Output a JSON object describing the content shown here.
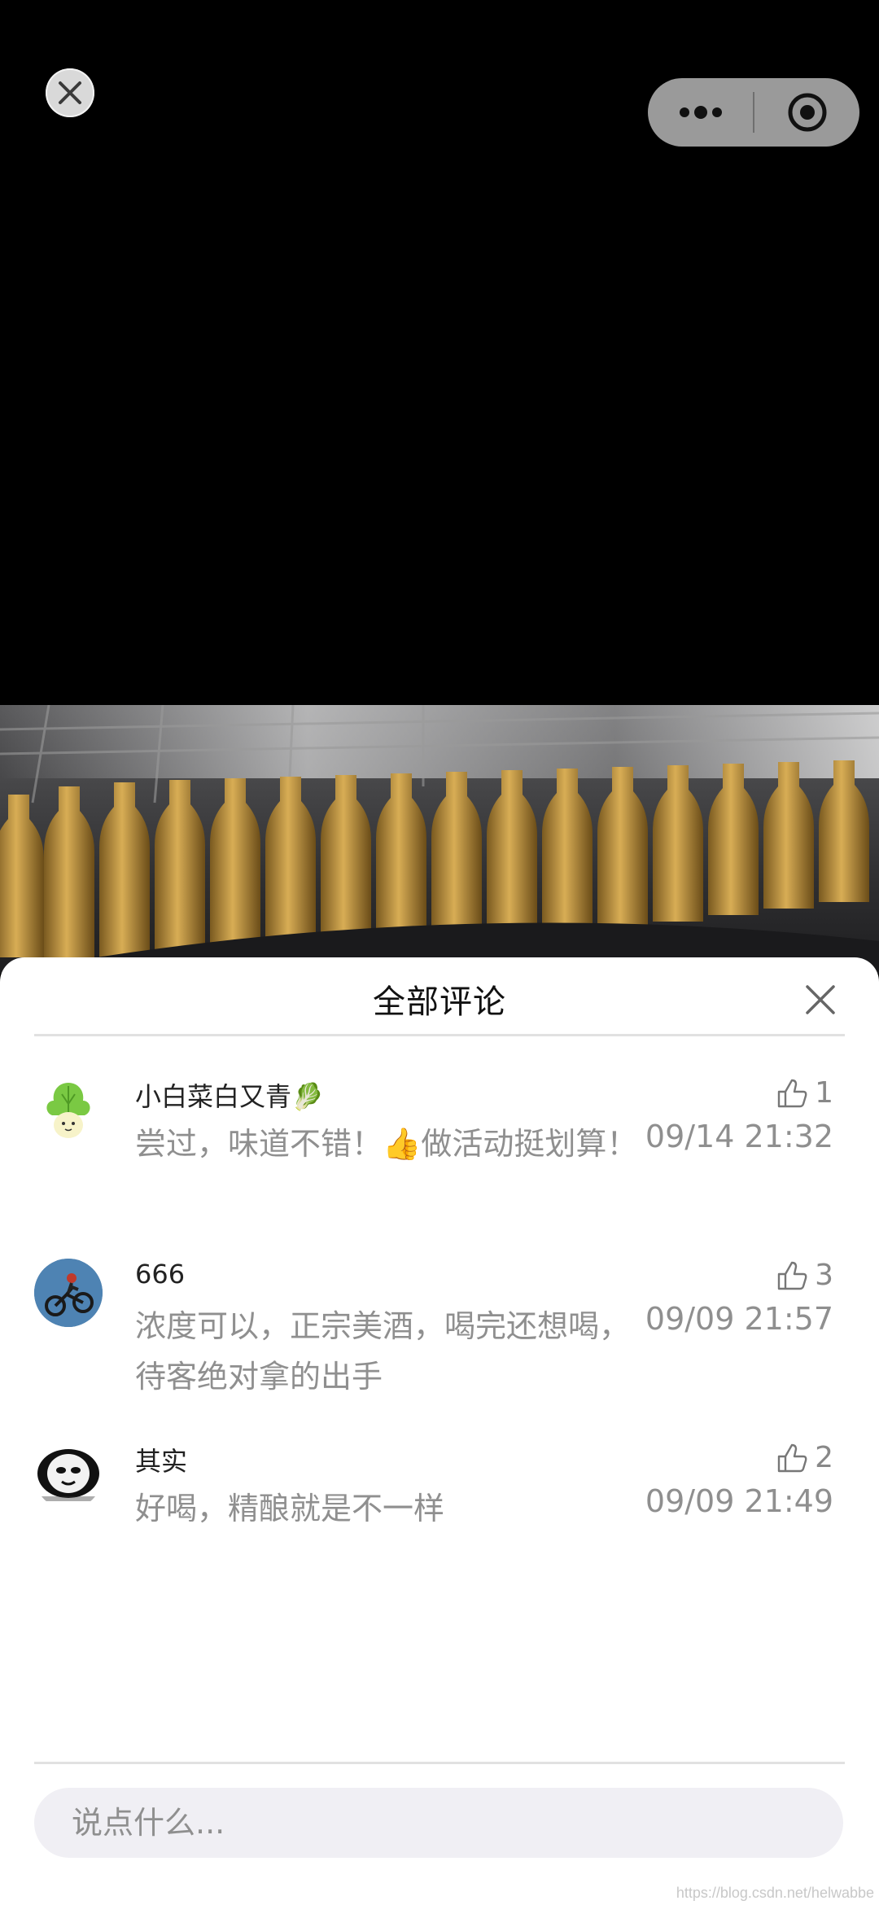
{
  "colors": {
    "sheet_bg": "#ffffff",
    "text_gray": "#8f8f8f",
    "input_bg": "#f0eff4"
  },
  "topbar": {
    "close_icon": "close-icon",
    "more_icon": "more-dots-icon",
    "target_icon": "target-icon"
  },
  "sheet": {
    "title": "全部评论",
    "close_icon": "close-icon"
  },
  "comments": [
    {
      "name": "小白菜白又青🥬",
      "text": "尝过，味道不错！👍做活动挺划算！",
      "likes": "1",
      "time": "09/14 21:32",
      "avatar": "cabbage-avatar"
    },
    {
      "name": "666",
      "text": "浓度可以，正宗美酒，喝完还想喝，待客绝对拿的出手",
      "likes": "3",
      "time": "09/09 21:57",
      "avatar": "motocross-avatar"
    },
    {
      "name": "其实",
      "text": "好喝，精酿就是不一样",
      "likes": "2",
      "time": "09/09 21:49",
      "avatar": "panda-meme-avatar"
    }
  ],
  "input": {
    "placeholder": "说点什么..."
  },
  "watermark": "https://blog.csdn.net/helwabbe"
}
